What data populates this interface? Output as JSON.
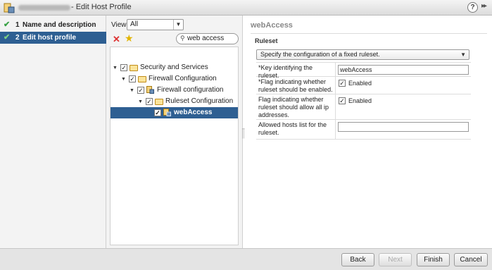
{
  "window": {
    "title": "- Edit Host Profile",
    "help_label": "?",
    "expand_label": "▸▸"
  },
  "wizard": {
    "steps": [
      {
        "number": "1",
        "label": "Name and description",
        "completed": true,
        "active": false
      },
      {
        "number": "2",
        "label": "Edit host profile",
        "completed": true,
        "active": true
      }
    ]
  },
  "tree_panel": {
    "view_label": "View:",
    "view_value": "All",
    "search_value": "web access",
    "items": [
      {
        "label": "Security and Services",
        "checked": true,
        "expanded": true,
        "icon": "folder-icon"
      },
      {
        "label": "Firewall Configuration",
        "checked": true,
        "expanded": true,
        "icon": "folder-icon"
      },
      {
        "label": "Firewall configuration",
        "checked": true,
        "expanded": true,
        "icon": "firewall-icon"
      },
      {
        "label": "Ruleset Configuration",
        "checked": true,
        "expanded": true,
        "icon": "folder-icon"
      },
      {
        "label": "webAccess",
        "checked": true,
        "selected": true,
        "icon": "firewall-icon"
      }
    ]
  },
  "detail": {
    "title": "webAccess",
    "section": "Ruleset",
    "ruleset_option": "Specify the configuration of a fixed ruleset.",
    "properties": [
      {
        "label": "*Key identifying the ruleset.",
        "type": "text",
        "value": "webAccess"
      },
      {
        "label": "*Flag indicating whether ruleset should be enabled.",
        "type": "checkbox",
        "checked": true,
        "value": "Enabled"
      },
      {
        "label": "Flag indicating whether ruleset should allow all ip addresses.",
        "type": "checkbox",
        "checked": true,
        "value": "Enabled"
      },
      {
        "label": "Allowed hosts list for the ruleset.",
        "type": "text",
        "value": ""
      }
    ]
  },
  "footer": {
    "back": "Back",
    "next": "Next",
    "finish": "Finish",
    "cancel": "Cancel"
  },
  "colors": {
    "selection": "#2e5f92",
    "check_green": "#36a043",
    "delete_red": "#dd3333"
  }
}
